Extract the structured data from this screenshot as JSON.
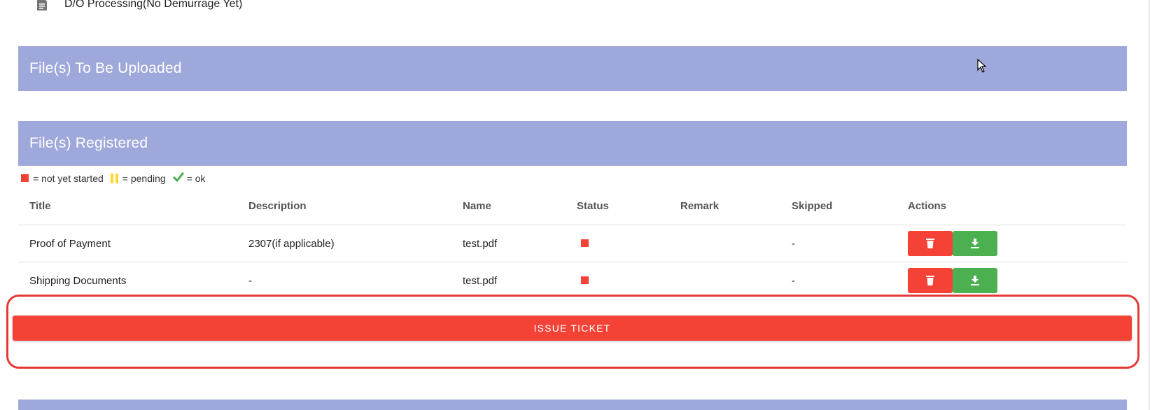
{
  "top_status": {
    "icon": "document-icon",
    "text": "D/O Processing(No Demurrage Yet)"
  },
  "upload_panel": {
    "title": "File(s) To Be Uploaded"
  },
  "registered_panel": {
    "title": "File(s) Registered"
  },
  "legend": {
    "not_started": "= not yet started",
    "pending": "= pending",
    "ok": "= ok",
    "colors": {
      "not_started": "#f44336",
      "pending": "#fdd835",
      "ok": "#4caf50"
    }
  },
  "table": {
    "headers": {
      "title": "Title",
      "description": "Description",
      "name": "Name",
      "status": "Status",
      "remark": "Remark",
      "skipped": "Skipped",
      "actions": "Actions"
    },
    "rows": [
      {
        "title": "Proof of Payment",
        "description": "2307(if applicable)",
        "name": "test.pdf",
        "status": "not yet started",
        "remark": "",
        "skipped": "-"
      },
      {
        "title": "Shipping Documents",
        "description": "-",
        "name": "test.pdf",
        "status": "not yet started",
        "remark": "",
        "skipped": "-"
      }
    ]
  },
  "issue_ticket": {
    "label": "ISSUE TICKET"
  },
  "colors": {
    "header_bg": "#9fa8da",
    "danger": "#f44336",
    "success": "#4caf50"
  }
}
